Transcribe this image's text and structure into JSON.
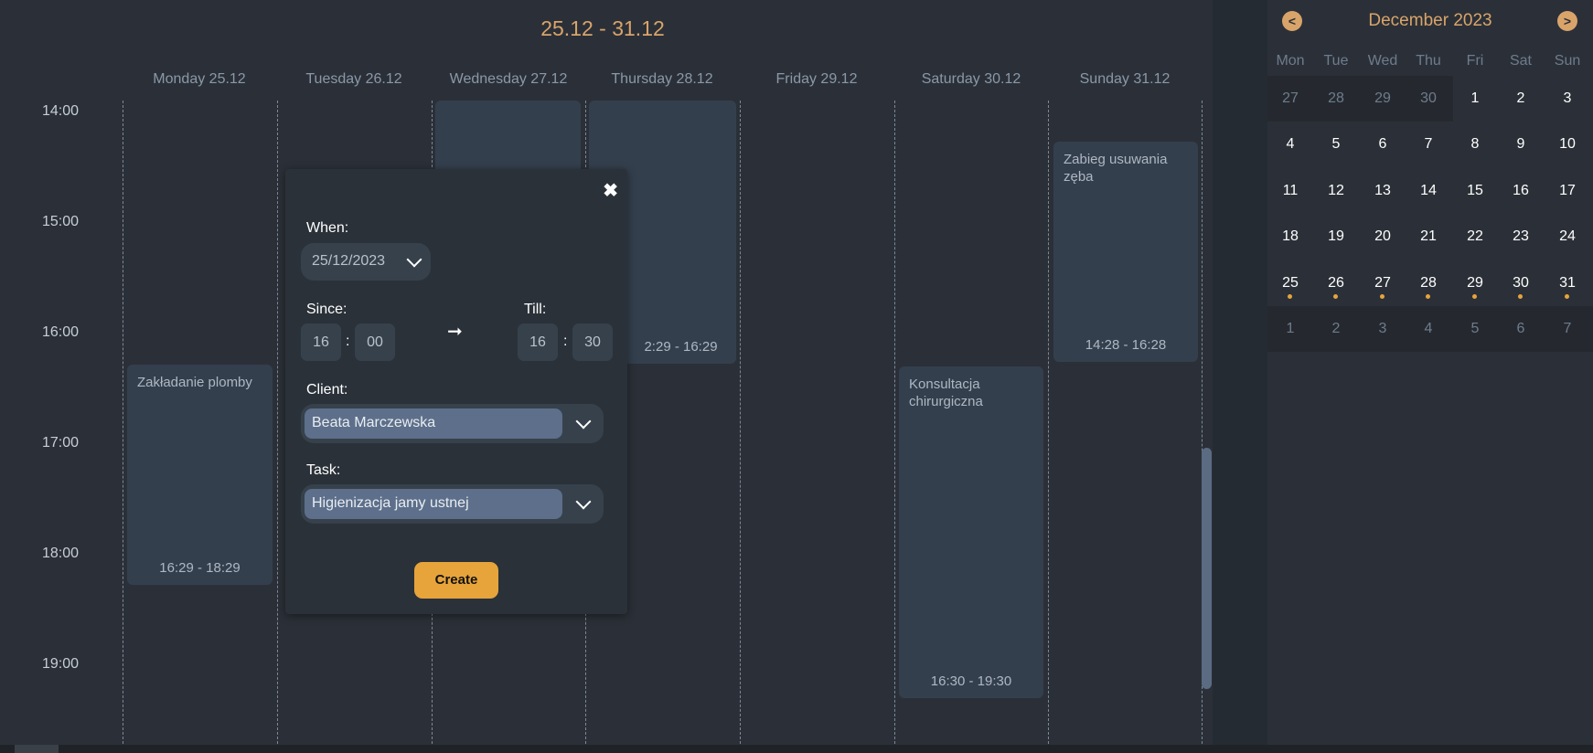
{
  "week": {
    "title": "25.12 - 31.12",
    "days": [
      "Monday 25.12",
      "Tuesday 26.12",
      "Wednesday 27.12",
      "Thursday 28.12",
      "Friday 29.12",
      "Saturday 30.12",
      "Sunday 31.12"
    ],
    "times": [
      "14:00",
      "15:00",
      "16:00",
      "17:00",
      "18:00",
      "19:00"
    ]
  },
  "events": [
    {
      "title": "",
      "time": ""
    },
    {
      "title": "",
      "time": "2:29 - 16:29"
    },
    {
      "title": "Zakładanie plomby",
      "time": "16:29 - 18:29"
    },
    {
      "title": "Konsultacja chirurgiczna",
      "time": "16:30 - 19:30"
    },
    {
      "title": "Zabieg usuwania zęba",
      "time": "14:28 - 16:28"
    }
  ],
  "modal": {
    "close": "✖",
    "when_label": "When:",
    "date_value": "25/12/2023",
    "since_label": "Since:",
    "till_label": "Till:",
    "since_hour": "16",
    "since_min": "00",
    "till_hour": "16",
    "till_min": "30",
    "separator": ":",
    "arrow": "➞",
    "client_label": "Client:",
    "client_value": "Beata Marczewska",
    "task_label": "Task:",
    "task_value": "Higienizacja jamy ustnej",
    "create_label": "Create"
  },
  "calendar": {
    "month": "December 2023",
    "prev": "<",
    "next": ">",
    "weekdays": [
      "Mon",
      "Tue",
      "Wed",
      "Thu",
      "Fri",
      "Sat",
      "Sun"
    ],
    "weeks": [
      [
        "27",
        "28",
        "29",
        "30",
        "1",
        "2",
        "3"
      ],
      [
        "4",
        "5",
        "6",
        "7",
        "8",
        "9",
        "10"
      ],
      [
        "11",
        "12",
        "13",
        "14",
        "15",
        "16",
        "17"
      ],
      [
        "18",
        "19",
        "20",
        "21",
        "22",
        "23",
        "24"
      ],
      [
        "25",
        "26",
        "27",
        "28",
        "29",
        "30",
        "31"
      ],
      [
        "1",
        "2",
        "3",
        "4",
        "5",
        "6",
        "7"
      ]
    ],
    "colors": {
      "accent": "#d9a46a",
      "dot": "#e7a43a",
      "event": "#343f4d"
    }
  }
}
